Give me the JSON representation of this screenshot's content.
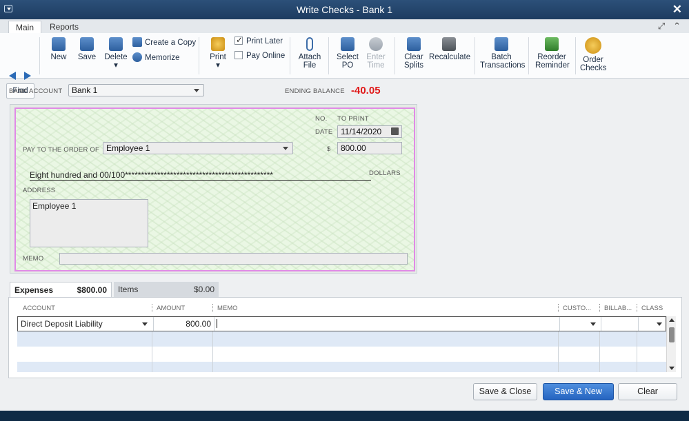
{
  "window": {
    "title": "Write Checks - Bank 1"
  },
  "ribbon_tabs": [
    "Main",
    "Reports"
  ],
  "toolbar": {
    "find": "Find",
    "new": "New",
    "save": "Save",
    "delete": "Delete",
    "create_copy": "Create a Copy",
    "memorize": "Memorize",
    "print": "Print",
    "print_later": "Print Later",
    "pay_online": "Pay Online",
    "attach_l1": "Attach",
    "attach_l2": "File",
    "select_l1": "Select",
    "select_l2": "PO",
    "enter_l1": "Enter",
    "enter_l2": "Time",
    "clear_l1": "Clear",
    "clear_l2": "Splits",
    "recalculate": "Recalculate",
    "batch_l1": "Batch",
    "batch_l2": "Transactions",
    "reorder_l1": "Reorder",
    "reorder_l2": "Reminder",
    "order_l1": "Order",
    "order_l2": "Checks",
    "print_later_checked": true,
    "pay_online_checked": false
  },
  "header": {
    "bank_account_label": "BANK ACCOUNT",
    "bank_account": "Bank 1",
    "ending_balance_label": "ENDING BALANCE",
    "ending_balance": "-40.05",
    "ending_balance_color": "#e01a1a"
  },
  "check": {
    "no_label": "NO.",
    "no_value": "TO PRINT",
    "date_label": "DATE",
    "date": "11/14/2020",
    "pay_to_label": "PAY TO THE ORDER OF",
    "payee": "Employee 1",
    "dollar_sign": "$",
    "amount": "800.00",
    "amount_words": "Eight hundred and 00/100**********************************************",
    "dollars_label": "DOLLARS",
    "address_label": "ADDRESS",
    "address": "Employee 1",
    "memo_label": "MEMO"
  },
  "detail_tabs": [
    {
      "label": "Expenses",
      "amount": "$800.00"
    },
    {
      "label": "Items",
      "amount": "$0.00"
    }
  ],
  "grid": {
    "headers": [
      "ACCOUNT",
      "AMOUNT",
      "MEMO",
      "CUSTO...",
      "BILLAB...",
      "CLASS"
    ],
    "rows": [
      {
        "account": "Direct Deposit Liability",
        "amount": "800.00",
        "memo": ""
      }
    ]
  },
  "buttons": {
    "save_close": "Save & Close",
    "save_new": "Save & New",
    "clear": "Clear"
  }
}
